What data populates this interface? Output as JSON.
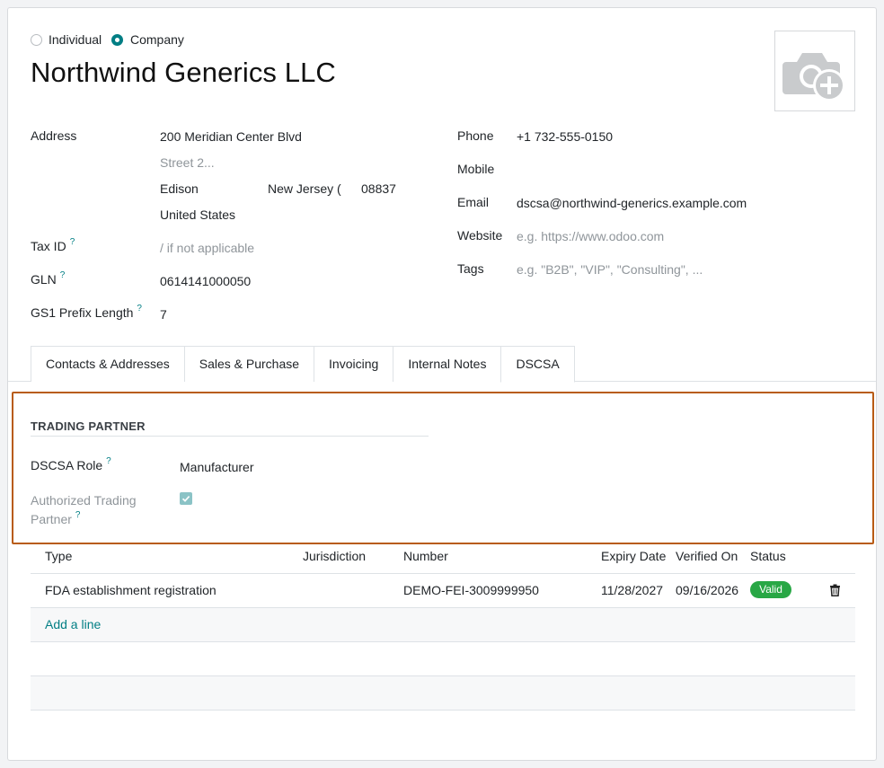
{
  "company_type": {
    "individual_label": "Individual",
    "company_label": "Company",
    "selected": "Company"
  },
  "partner_name": "Northwind Generics LLC",
  "left_fields": {
    "address_label": "Address",
    "street": "200 Meridian Center Blvd",
    "street2_placeholder": "Street 2...",
    "city": "Edison",
    "state": "New Jersey (",
    "zip": "08837",
    "country": "United States",
    "tax_id_label": "Tax ID",
    "tax_id_placeholder": "/ if not applicable",
    "gln_label": "GLN",
    "gln_value": "0614141000050",
    "gs1_label": "GS1 Prefix Length",
    "gs1_value": "7",
    "help_mark": "?"
  },
  "right_fields": {
    "phone_label": "Phone",
    "phone_value": "+1 732-555-0150",
    "mobile_label": "Mobile",
    "email_label": "Email",
    "email_value": "dscsa@northwind-generics.example.com",
    "website_label": "Website",
    "website_placeholder": "e.g. https://www.odoo.com",
    "tags_label": "Tags",
    "tags_placeholder": "e.g. \"B2B\", \"VIP\", \"Consulting\", ..."
  },
  "tabs": [
    {
      "label": "Contacts & Addresses",
      "active": false
    },
    {
      "label": "Sales & Purchase",
      "active": false
    },
    {
      "label": "Invoicing",
      "active": false
    },
    {
      "label": "Internal Notes",
      "active": false
    },
    {
      "label": "DSCSA",
      "active": true
    }
  ],
  "dscsa": {
    "section_title": "TRADING PARTNER",
    "role_label": "DSCSA Role",
    "role_value": "Manufacturer",
    "authorized_label_line1": "Authorized Trading",
    "authorized_label_line2": "Partner",
    "authorized_checked": true
  },
  "license_table": {
    "columns": [
      "Type",
      "Jurisdiction",
      "Number",
      "Expiry Date",
      "Verified On",
      "Status"
    ],
    "rows": [
      {
        "type": "FDA establishment registration",
        "jurisdiction": "",
        "number": "DEMO-FEI-3009999950",
        "expiry": "11/28/2027",
        "verified": "09/16/2026",
        "status": "Valid"
      }
    ],
    "add_line_label": "Add a line"
  },
  "colors": {
    "accent": "#017e84",
    "highlight_border": "#b85c15",
    "valid_badge": "#28a745"
  },
  "icons": {
    "avatar": "camera-plus-icon",
    "delete": "trash-icon",
    "checkbox": "check-icon"
  }
}
